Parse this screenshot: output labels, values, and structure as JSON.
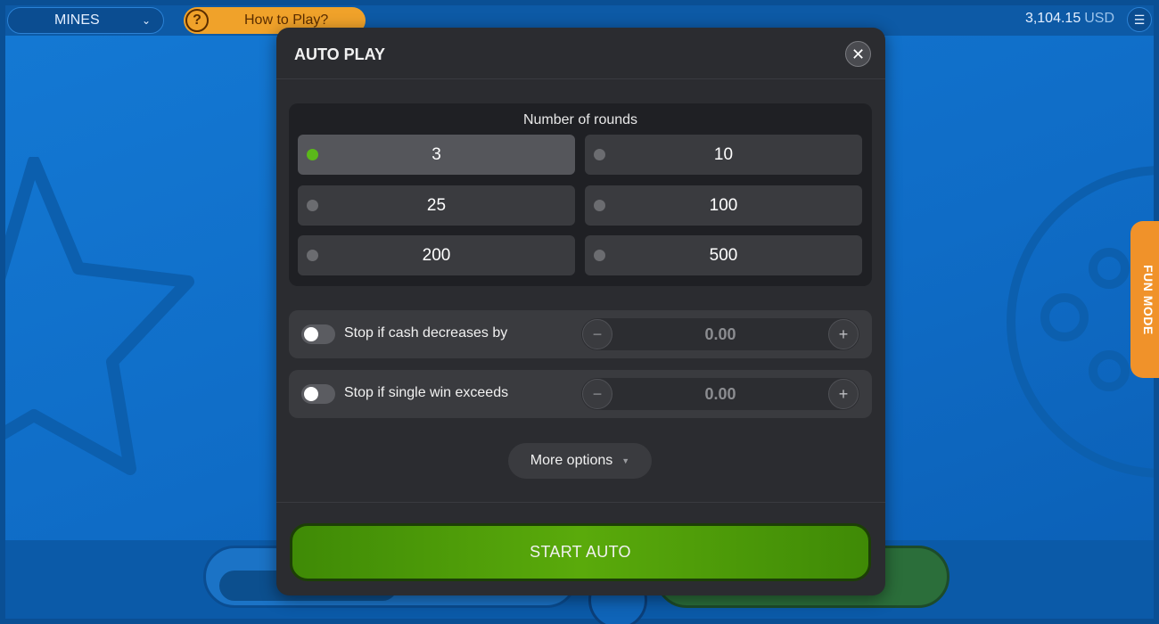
{
  "topbar": {
    "game": "MINES",
    "how_to_play": "How to Play?",
    "balance_amount": "3,104.15",
    "balance_currency": "USD"
  },
  "side_tab": {
    "label": "FUN MODE"
  },
  "modal": {
    "title": "AUTO PLAY",
    "rounds_title": "Number of rounds",
    "rounds": [
      "3",
      "10",
      "25",
      "100",
      "200",
      "500"
    ],
    "selected_round": "3",
    "stop_cash_decrease": {
      "label": "Stop if cash decreases by",
      "value": "0.00",
      "enabled": false
    },
    "stop_single_win": {
      "label": "Stop if single win exceeds",
      "value": "0.00",
      "enabled": false
    },
    "more_options": "More options",
    "start_button": "START AUTO"
  },
  "colors": {
    "accent_green": "#5aaa0b",
    "selected_dot": "#5bb81a",
    "fun_mode_orange": "#f0922a",
    "how_to_orange": "#f0a22a"
  }
}
